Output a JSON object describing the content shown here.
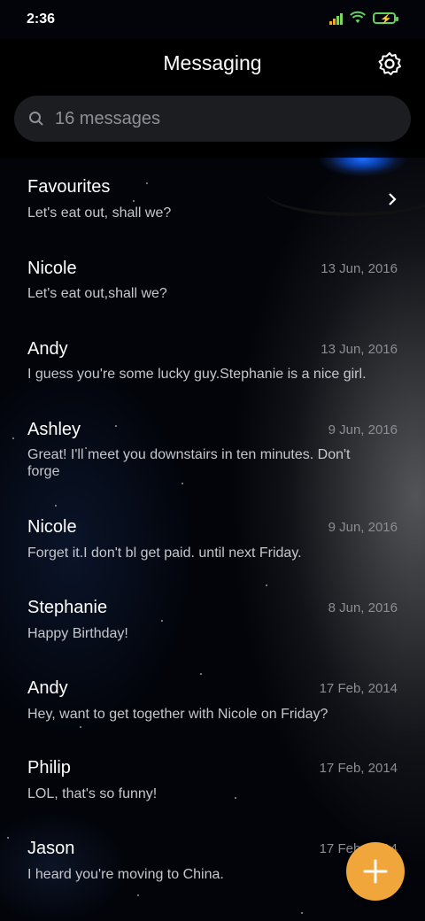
{
  "status_bar": {
    "time": "2:36"
  },
  "header": {
    "title": "Messaging"
  },
  "search": {
    "text": "16 messages"
  },
  "conversations": [
    {
      "name": "Favourites",
      "date": "",
      "preview": "Let's eat out, shall we?"
    },
    {
      "name": "Nicole",
      "date": "13 Jun, 2016",
      "preview": "Let's eat out,shall we?"
    },
    {
      "name": "Andy",
      "date": "13 Jun, 2016",
      "preview": "I guess you're some lucky guy.Stephanie is a nice girl."
    },
    {
      "name": "Ashley",
      "date": "9 Jun, 2016",
      "preview": "Great! I'll meet you downstairs in ten minutes. Don't forge"
    },
    {
      "name": "Nicole",
      "date": "9 Jun, 2016",
      "preview": "Forget it.I don't bl get paid. until next Friday."
    },
    {
      "name": "Stephanie",
      "date": "8 Jun, 2016",
      "preview": "Happy Birthday!"
    },
    {
      "name": "Andy",
      "date": "17 Feb, 2014",
      "preview": "Hey, want to get together with Nicole on Friday?"
    },
    {
      "name": "Philip",
      "date": "17 Feb, 2014",
      "preview": "LOL, that's so funny!"
    },
    {
      "name": "Jason",
      "date": "17 Feb, 2014",
      "preview": "I heard you're moving to China."
    }
  ],
  "icons": {
    "settings": "gear-icon",
    "search": "search-icon",
    "compose": "plus-icon",
    "favourites_arrow": "chevron-right-icon"
  },
  "colors": {
    "accent": "#f0a63a",
    "background": "#02040a"
  }
}
